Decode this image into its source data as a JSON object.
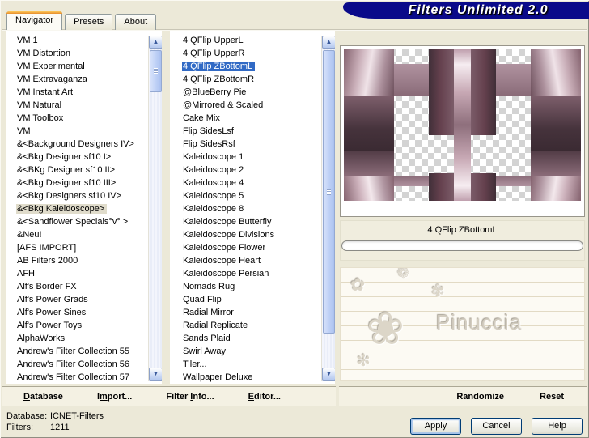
{
  "window": {
    "title": "Filters Unlimited 2.0"
  },
  "tabs": [
    {
      "label": "Navigator",
      "active": true
    },
    {
      "label": "Presets",
      "active": false
    },
    {
      "label": "About",
      "active": false
    }
  ],
  "category_list": {
    "items": [
      "VM 1",
      "VM Distortion",
      "VM Experimental",
      "VM Extravaganza",
      "VM Instant Art",
      "VM Natural",
      "VM Toolbox",
      "VM",
      "&<Background Designers IV>",
      "&<Bkg Designer sf10 I>",
      "&<BKg Designer sf10 II>",
      "&<Bkg Designer sf10 III>",
      "&<Bkg Designers sf10 IV>",
      {
        "label": "&<Bkg Kaleidoscope>",
        "selected": true
      },
      "&<Sandflower Specials°v° >",
      "&Neu!",
      "[AFS IMPORT]",
      "AB Filters 2000",
      "AFH",
      "Alf's Border FX",
      "Alf's Power Grads",
      "Alf's Power Sines",
      "Alf's Power Toys",
      "AlphaWorks",
      "Andrew's Filter Collection 55",
      "Andrew's Filter Collection 56",
      "Andrew's Filter Collection 57"
    ],
    "selected_item": "&<Bkg Kaleidoscope>"
  },
  "filter_list": {
    "items": [
      "4 QFlip UpperL",
      "4 QFlip UpperR",
      {
        "label": "4 QFlip ZBottomL",
        "selected": true
      },
      "4 QFlip ZBottomR",
      "@BlueBerry Pie",
      "@Mirrored & Scaled",
      "Cake Mix",
      "Flip SidesLsf",
      "Flip SidesRsf",
      "Kaleidoscope 1",
      "Kaleidoscope 2",
      "Kaleidoscope 4",
      "Kaleidoscope 5",
      "Kaleidoscope 8",
      "Kaleidoscope Butterfly",
      "Kaleidoscope Divisions",
      "Kaleidoscope Flower",
      "Kaleidoscope Heart",
      "Kaleidoscope Persian",
      "Nomads Rug",
      "Quad Flip",
      "Radial Mirror",
      "Radial Replicate",
      "Sands Plaid",
      "Swirl Away",
      "Tiler...",
      "Wallpaper Deluxe"
    ],
    "selected_item": "4 QFlip ZBottomL"
  },
  "preview": {
    "caption": "4 QFlip ZBottomL",
    "progress_percent": 0,
    "watermark_text": "Pinuccia",
    "watermark_flowers": [
      "❀",
      "✿",
      "❁",
      "✾",
      "✻"
    ]
  },
  "icons": {
    "scroll_up": "▲",
    "scroll_down": "▼"
  },
  "toolbar": {
    "database": {
      "pre": "",
      "key": "D",
      "post": "atabase"
    },
    "import": {
      "pre": "I",
      "key": "m",
      "post": "port..."
    },
    "filter_info": {
      "pre": "Filter ",
      "key": "I",
      "post": "nfo..."
    },
    "editor": {
      "pre": "",
      "key": "E",
      "post": "ditor..."
    },
    "randomize": "Randomize",
    "reset": "Reset"
  },
  "status": {
    "database_label": "Database:",
    "database_value": "ICNET-Filters",
    "filters_label": "Filters:",
    "filters_value": "1211"
  },
  "action_buttons": {
    "apply": "Apply",
    "cancel": "Cancel",
    "help": "Help"
  },
  "colors": {
    "title_banner": "#0a0a8a",
    "selection_highlight": "#316ac5",
    "inactive_selection": "#e0dccb",
    "active_tab_accent": "#e68b2c",
    "window_background": "#ece9d8",
    "preview_dark_plum": "#46333c",
    "preview_mauve": "#c9aeb8"
  }
}
